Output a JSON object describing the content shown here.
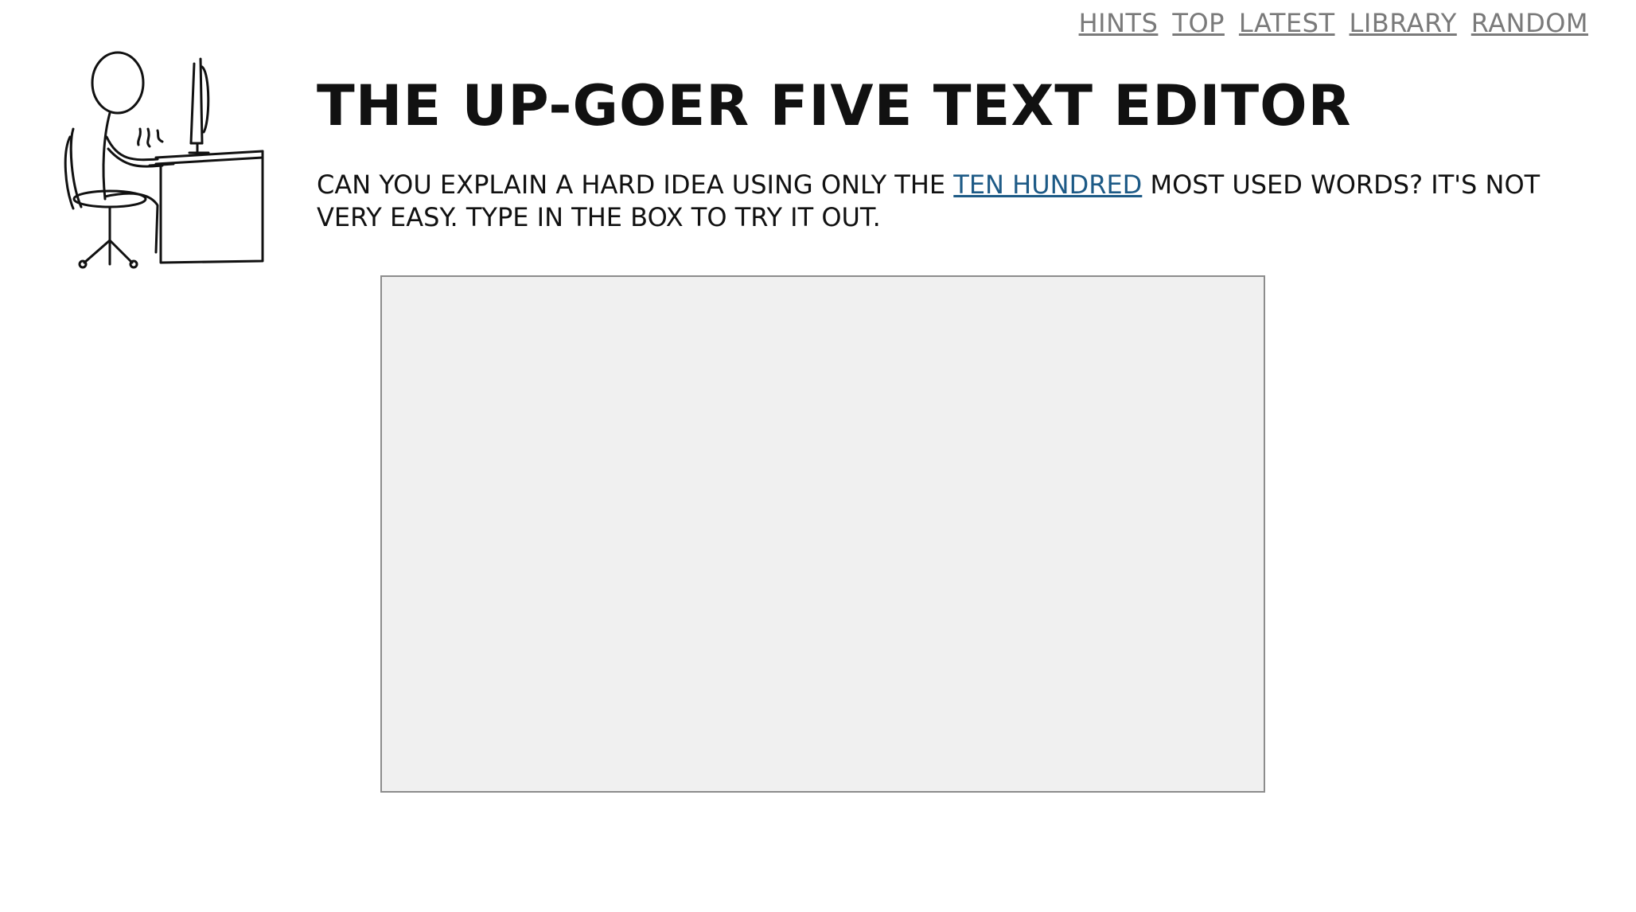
{
  "nav": {
    "items": [
      {
        "label": "HINTS"
      },
      {
        "label": "TOP"
      },
      {
        "label": "LATEST"
      },
      {
        "label": "LIBRARY"
      },
      {
        "label": "RANDOM"
      }
    ]
  },
  "header": {
    "title": "THE UP-GOER FIVE TEXT EDITOR",
    "illustration_icon": "stick-figure-at-computer-desk"
  },
  "intro": {
    "text_before_link": "CAN YOU EXPLAIN A HARD IDEA USING ONLY THE ",
    "link_label": "TEN HUNDRED",
    "text_after_link": " MOST USED WORDS? IT'S NOT VERY EASY. TYPE IN THE BOX TO TRY IT OUT."
  },
  "editor": {
    "value": "",
    "placeholder": ""
  },
  "colors": {
    "nav_link": "#7a7a7a",
    "inline_link": "#1d5a86",
    "editor_background": "#f0f0f0",
    "editor_border": "#8c8c8c"
  }
}
